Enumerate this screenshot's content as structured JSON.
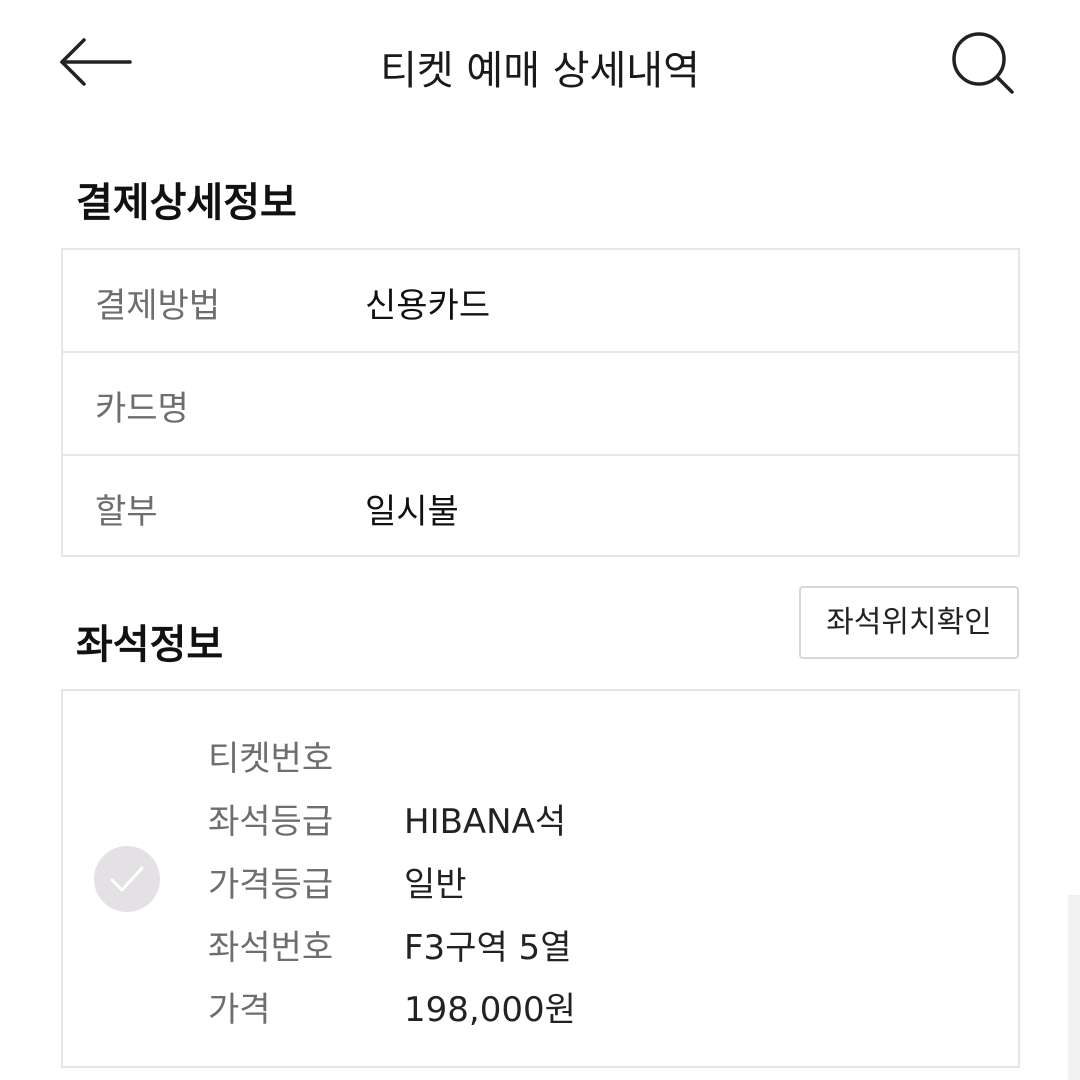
{
  "header": {
    "title": "티켓 예매 상세내역",
    "back_icon": "arrow-left-icon",
    "search_icon": "search-icon"
  },
  "payment": {
    "section_title": "결제상세정보",
    "rows": [
      {
        "label": "결제방법",
        "value": "신용카드"
      },
      {
        "label": "카드명",
        "value": ""
      },
      {
        "label": "할부",
        "value": "일시불"
      }
    ]
  },
  "seat": {
    "section_title": "좌석정보",
    "location_button": "좌석위치확인",
    "check_icon": "check-icon",
    "rows": [
      {
        "label": "티켓번호",
        "value": ""
      },
      {
        "label": "좌석등급",
        "value": "HIBANA석"
      },
      {
        "label": "가격등급",
        "value": "일반"
      },
      {
        "label": "좌석번호",
        "value": "F3구역 5열"
      },
      {
        "label": "가격",
        "value": "198,000원"
      }
    ]
  },
  "colors": {
    "text_primary": "#111111",
    "text_secondary": "#6e6e6e",
    "border": "#e6e6e6",
    "check_bg": "#e3e1e4"
  }
}
